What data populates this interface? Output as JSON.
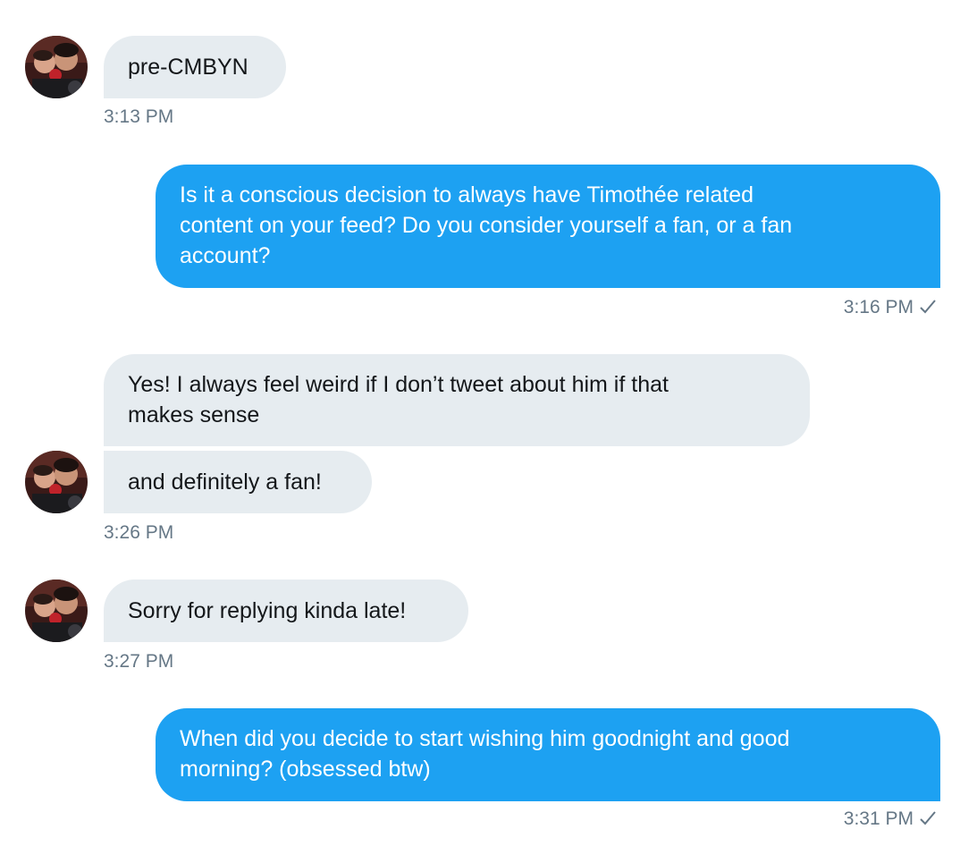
{
  "conversation": {
    "messages": [
      {
        "direction": "incoming",
        "lines": [
          "pre-CMBYN"
        ],
        "time": "3:13 PM"
      },
      {
        "direction": "outgoing",
        "lines": [
          "Is it a conscious decision to always have Timothée related",
          "content on your feed? Do you consider yourself a fan, or a fan",
          "account?"
        ],
        "time": "3:16 PM"
      },
      {
        "direction": "incoming",
        "lines": [
          "Yes! I always feel weird if I don’t tweet about him if that",
          "makes sense"
        ]
      },
      {
        "direction": "incoming",
        "lines": [
          "and definitely a fan!"
        ],
        "time": "3:26 PM"
      },
      {
        "direction": "incoming",
        "lines": [
          "Sorry for replying kinda late!"
        ],
        "time": "3:27 PM"
      },
      {
        "direction": "outgoing",
        "lines": [
          "When did you decide to start wishing him goodnight and good",
          "morning? (obsessed btw)"
        ],
        "time": "3:31 PM"
      }
    ]
  },
  "colors": {
    "incoming_bubble": "#e6ecf0",
    "outgoing_bubble": "#1da1f2",
    "timestamp": "#657786"
  },
  "icons": {
    "avatar": "profile-photo",
    "sent": "checkmark-icon"
  }
}
